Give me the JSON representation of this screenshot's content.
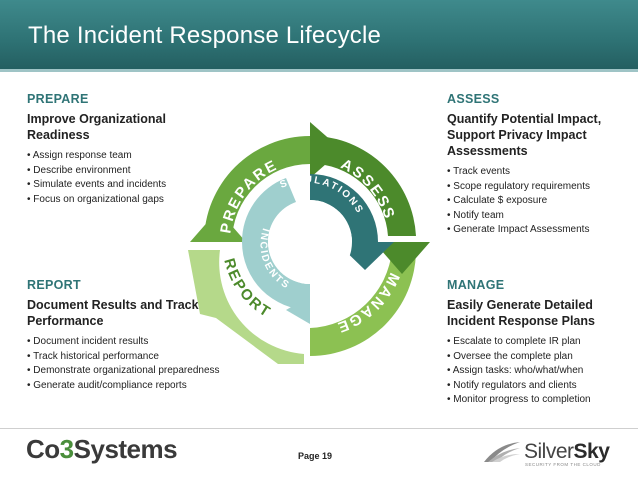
{
  "header": {
    "title": "The Incident Response Lifecycle"
  },
  "quadrants": {
    "prepare": {
      "heading": "PREPARE",
      "subtitle": "Improve Organizational Readiness",
      "items": [
        "Assign response team",
        "Describe environment",
        "Simulate events and incidents",
        "Focus on organizational gaps"
      ]
    },
    "assess": {
      "heading": "ASSESS",
      "subtitle": "Quantify Potential Impact, Support Privacy Impact Assessments",
      "items": [
        "Track events",
        "Scope regulatory requirements",
        "Calculate $ exposure",
        "Notify team",
        "Generate Impact Assessments"
      ]
    },
    "report": {
      "heading": "REPORT",
      "subtitle": "Document Results and Track Performance",
      "items": [
        "Document incident results",
        "Track historical performance",
        "Demonstrate organizational preparedness",
        "Generate audit/compliance reports"
      ]
    },
    "manage": {
      "heading": "MANAGE",
      "subtitle": "Easily Generate Detailed Incident Response Plans",
      "items": [
        "Escalate to complete IR plan",
        "Oversee the complete plan",
        "Assign tasks: who/what/when",
        "Notify regulators and clients",
        "Monitor progress to completion"
      ]
    }
  },
  "diagram": {
    "outer_labels": {
      "prepare": "PREPARE",
      "assess": "ASSESS",
      "manage": "MANAGE",
      "report": "REPORT"
    },
    "inner_labels": {
      "simulations": "SIMULATIONS",
      "incidents": "INCIDENTS"
    },
    "colors": {
      "green_light": "#8cc152",
      "green_mid": "#6aa83f",
      "green_dark": "#4c8a2b",
      "teal_dark": "#2f7476",
      "teal_light": "#9fcfce"
    }
  },
  "footer": {
    "page": "Page 19",
    "logo_left": {
      "prefix": "Co",
      "accent": "3",
      "suffix": "Systems"
    },
    "logo_right": {
      "light": "Silver",
      "bold": "Sky",
      "tagline": "SECURITY FROM THE CLOUD"
    }
  }
}
